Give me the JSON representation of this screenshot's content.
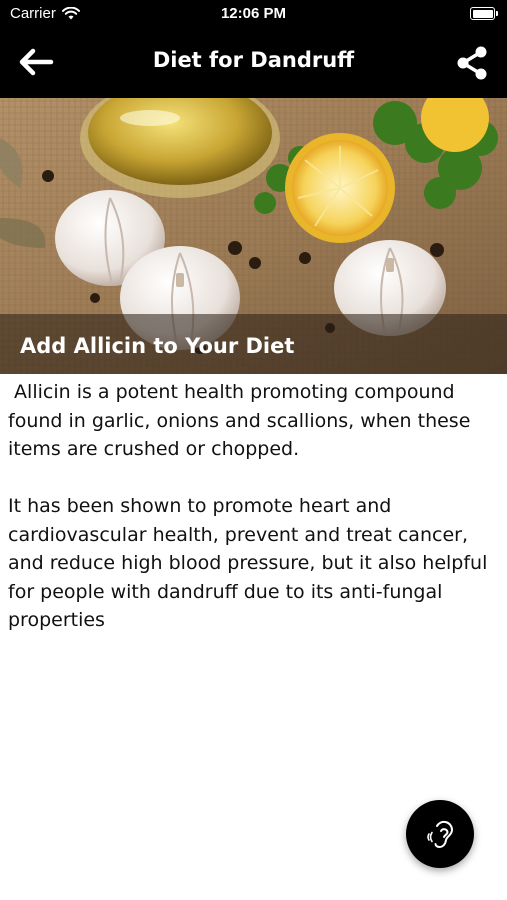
{
  "status_bar": {
    "carrier": "Carrier",
    "time": "12:06 PM",
    "wifi_icon": "wifi-icon",
    "battery_icon": "battery-icon"
  },
  "nav": {
    "title": "Diet for Dandruff",
    "back_icon": "arrow-left-icon",
    "share_icon": "share-icon"
  },
  "hero": {
    "caption": "Add Allicin to Your Diet",
    "image_subject": "garlic bulbs, olive oil, lemon half and parsley on burlap"
  },
  "article": {
    "paragraphs": [
      " Allicin is a potent health promoting compound found in garlic, onions and scallions, when these items are crushed or chopped.",
      "It has been shown to promote heart and cardiovascular health, prevent and treat cancer, and reduce high blood pressure, but it also helpful for people with dandruff due to its anti-fungal properties"
    ]
  },
  "fab": {
    "icon": "ear-listen-icon"
  },
  "colors": {
    "nav_background": "#000000",
    "nav_text": "#ffffff",
    "body_text": "#111111"
  }
}
